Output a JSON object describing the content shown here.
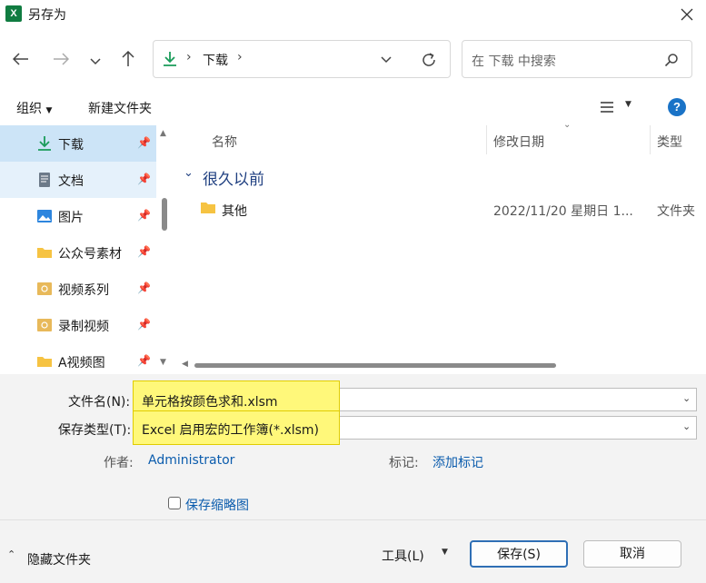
{
  "window": {
    "title": "另存为",
    "app_icon_letter": "X"
  },
  "nav": {
    "breadcrumb": [
      "下载"
    ],
    "search_placeholder": "在 下载 中搜索"
  },
  "toolbar": {
    "organize": "组织",
    "new_folder": "新建文件夹"
  },
  "sidebar": {
    "items": [
      {
        "label": "下载",
        "icon": "download-icon",
        "state": "selected"
      },
      {
        "label": "文档",
        "icon": "document-icon",
        "state": "hover"
      },
      {
        "label": "图片",
        "icon": "picture-icon",
        "state": ""
      },
      {
        "label": "公众号素材",
        "icon": "folder-icon",
        "state": ""
      },
      {
        "label": "视频系列",
        "icon": "video-folder-icon",
        "state": ""
      },
      {
        "label": "录制视频",
        "icon": "video-folder-icon",
        "state": ""
      },
      {
        "label": "A视频图",
        "icon": "folder-icon",
        "state": ""
      }
    ]
  },
  "files": {
    "columns": {
      "name": "名称",
      "modified": "修改日期",
      "type": "类型"
    },
    "group": "很久以前",
    "rows": [
      {
        "name": "其他",
        "modified": "2022/11/20 星期日 1...",
        "type": "文件夹"
      }
    ]
  },
  "form": {
    "filename_label": "文件名(N):",
    "filename_value": "单元格按颜色求和.xlsm",
    "filetype_label": "保存类型(T):",
    "filetype_value": "Excel 启用宏的工作簿(*.xlsm)",
    "author_label": "作者:",
    "author_value": "Administrator",
    "tags_label": "标记:",
    "tags_value": "添加标记",
    "thumbnail_label": "保存缩略图"
  },
  "footer": {
    "hide_folders": "隐藏文件夹",
    "tools": "工具(L)",
    "save": "保存(S)",
    "cancel": "取消"
  },
  "colors": {
    "selection": "#cce4f7",
    "highlight": "#fff87a",
    "link": "#0b5cad",
    "excel": "#107c41"
  }
}
